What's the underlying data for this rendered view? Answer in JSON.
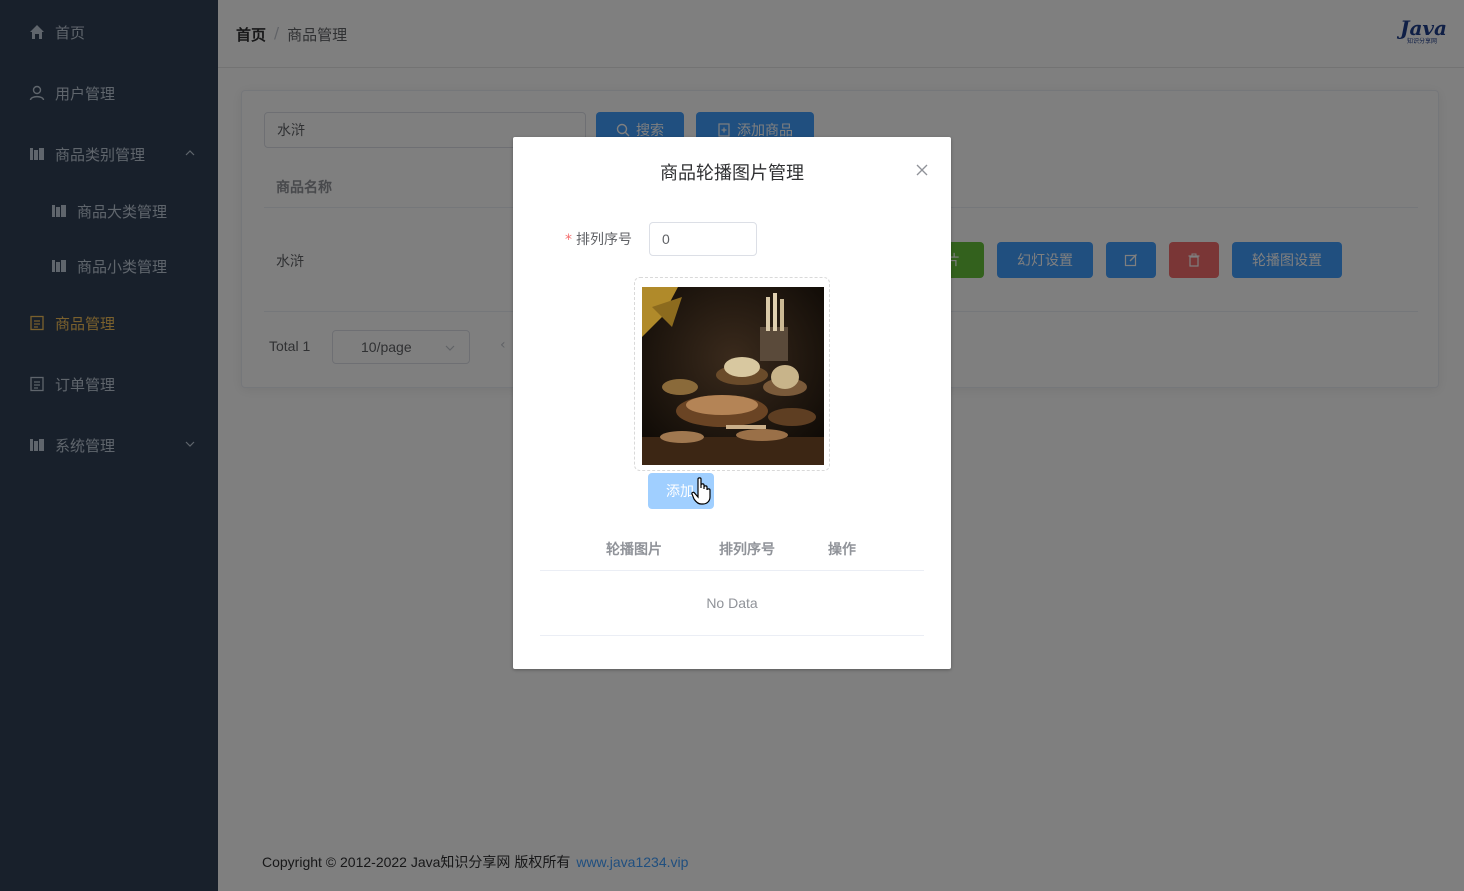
{
  "sidebar": {
    "items": [
      {
        "label": "首页",
        "icon": "home-icon"
      },
      {
        "label": "用户管理",
        "icon": "user-icon"
      },
      {
        "label": "商品类别管理",
        "icon": "category-icon",
        "expanded": true
      },
      {
        "label": "商品大类管理",
        "icon": "category-icon"
      },
      {
        "label": "商品小类管理",
        "icon": "category-icon"
      },
      {
        "label": "商品管理",
        "icon": "document-icon",
        "active": true
      },
      {
        "label": "订单管理",
        "icon": "document-icon"
      },
      {
        "label": "系统管理",
        "icon": "category-icon",
        "expanded": false
      }
    ]
  },
  "header": {
    "breadcrumb": [
      "首页",
      "商品管理"
    ],
    "logo": {
      "text": "Java",
      "subtext": "知识分享网"
    }
  },
  "main": {
    "search_value": "水浒",
    "search_button": "搜索",
    "add_button": "添加商品",
    "table": {
      "column_name": "商品名称",
      "rows": [
        {
          "name": "水浒"
        }
      ]
    },
    "row_buttons": {
      "partial_label": "片",
      "slide_label": "幻灯设置",
      "carousel_label": "轮播图设置"
    },
    "pagination": {
      "total": "Total 1",
      "page_size": "10/page",
      "prev": "‹"
    }
  },
  "footer": {
    "copyright": "Copyright © 2012-2022 Java知识分享网 版权所有",
    "link": "www.java1234.vip"
  },
  "dialog": {
    "title": "商品轮播图片管理",
    "order_label": "排列序号",
    "order_value": "0",
    "add_button": "添加",
    "table_headers": [
      "轮播图片",
      "排列序号",
      "操作"
    ],
    "empty_text": "No Data"
  },
  "colors": {
    "sidebar_bg": "#304156",
    "active_menu": "#f4c15a",
    "primary": "#409eff",
    "success": "#67c23a",
    "danger": "#f56c6c"
  }
}
